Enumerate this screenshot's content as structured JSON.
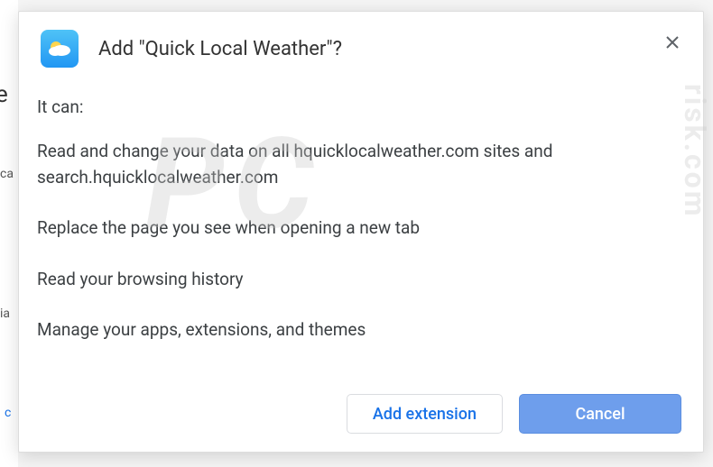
{
  "dialog": {
    "title": "Add \"Quick Local Weather\"?",
    "intro": "It can:",
    "permissions": [
      "Read and change your data on all hquicklocalweather.com sites and search.hquicklocalweather.com",
      "Replace the page you see when opening a new tab",
      "Read your browsing history",
      "Manage your apps, extensions, and themes"
    ],
    "buttons": {
      "add": "Add extension",
      "cancel": "Cancel"
    }
  },
  "background": {
    "frag1": "e",
    "frag2": "ca",
    "frag3": "ia",
    "frag4": "c"
  },
  "watermark": {
    "main": "PC",
    "side": "risk.com"
  }
}
